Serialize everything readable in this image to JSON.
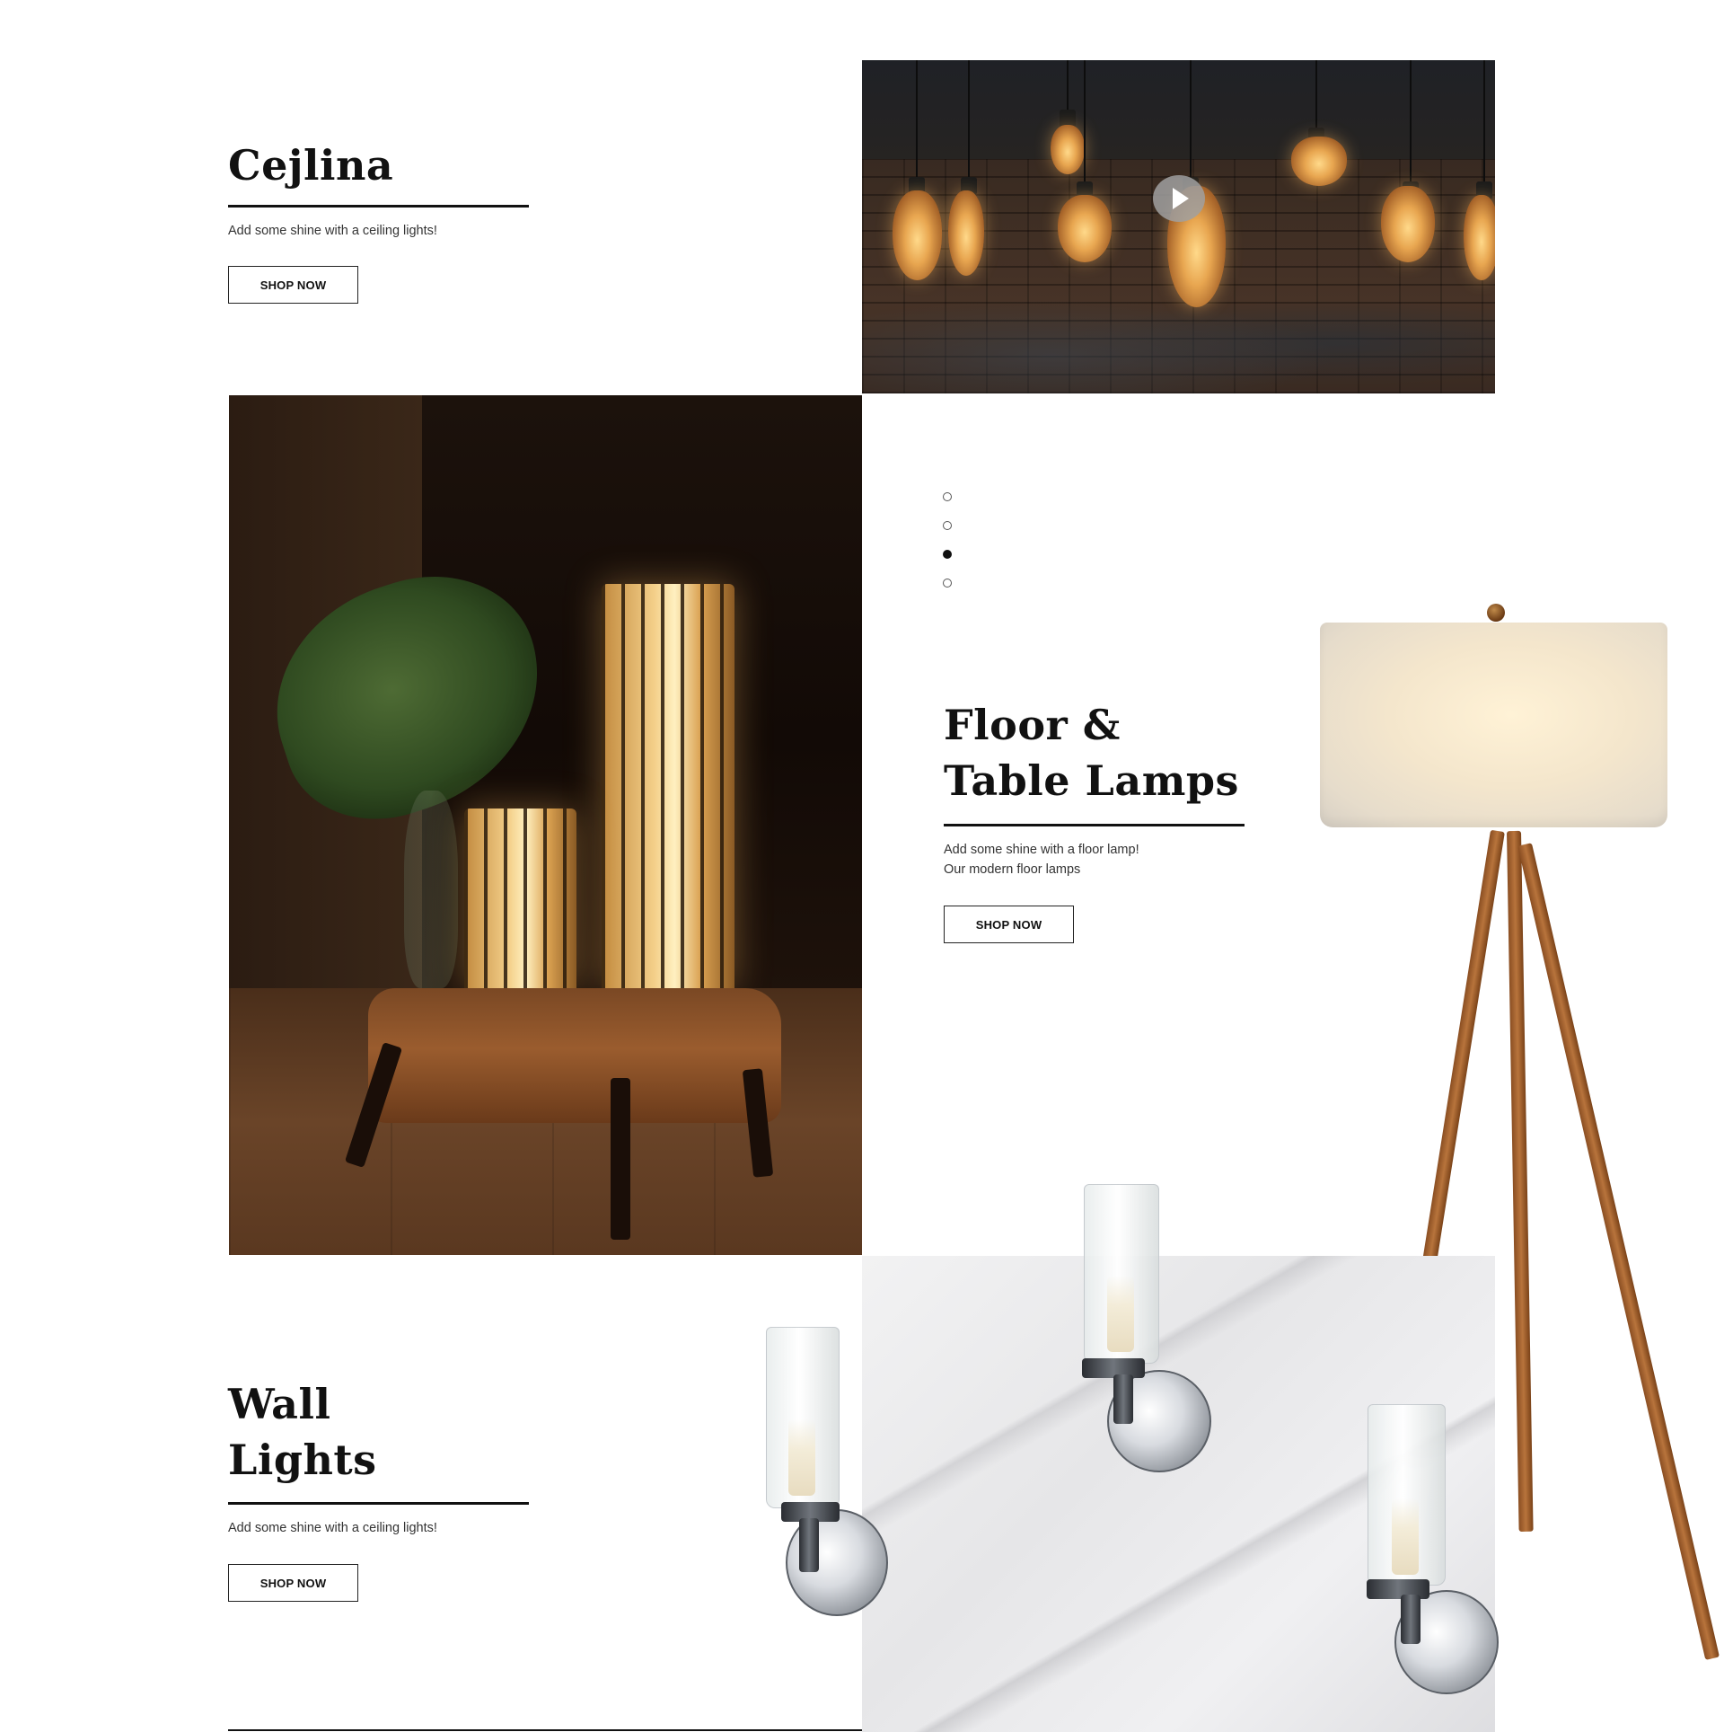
{
  "sections": {
    "ceiling": {
      "title": "Cejlina",
      "description": "Add some shine with a ceiling lights!",
      "button_label": "SHOP NOW"
    },
    "floor_table": {
      "title_line1": "Floor &",
      "title_line2": "Table Lamps",
      "description_line1": "Add some shine with a floor lamp!",
      "description_line2": "Our modern floor lamps",
      "button_label": "SHOP NOW"
    },
    "wall": {
      "title_line1": "Wall",
      "title_line2": "Lights",
      "description": "Add some shine with a ceiling lights!",
      "button_label": "SHOP NOW"
    }
  },
  "pagination": {
    "count": 4,
    "active_index": 3
  },
  "icons": {
    "video": "play-icon"
  }
}
